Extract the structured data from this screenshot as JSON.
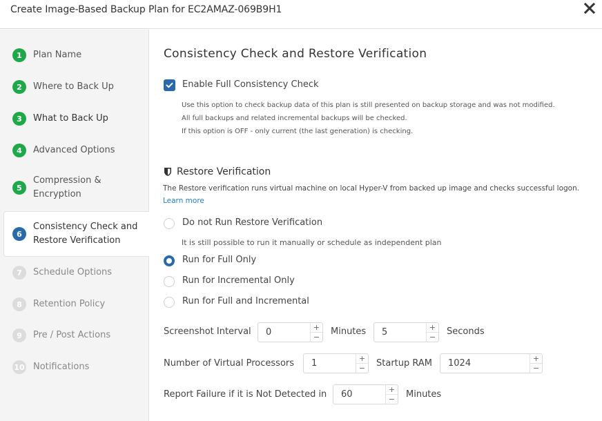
{
  "dialog": {
    "title": "Create Image-Based Backup Plan for EC2AMAZ-069B9H1",
    "close_icon": "close-x-icon"
  },
  "sidebar": {
    "steps": [
      {
        "number": "1",
        "label": "Plan Name",
        "state": "done"
      },
      {
        "number": "2",
        "label": "Where to Back Up",
        "state": "done"
      },
      {
        "number": "3",
        "label": "What to Back Up",
        "state": "done"
      },
      {
        "number": "4",
        "label": "Advanced Options",
        "state": "done"
      },
      {
        "number": "5",
        "label": "Compression & Encryption",
        "state": "done"
      },
      {
        "number": "6",
        "label": "Consistency Check and Restore Verification",
        "state": "active"
      },
      {
        "number": "7",
        "label": "Schedule Options",
        "state": "future"
      },
      {
        "number": "8",
        "label": "Retention Policy",
        "state": "future"
      },
      {
        "number": "9",
        "label": "Pre / Post Actions",
        "state": "future"
      },
      {
        "number": "10",
        "label": "Notifications",
        "state": "future"
      }
    ]
  },
  "main": {
    "title": "Consistency Check and Restore Verification",
    "consistency": {
      "checkbox_label": "Enable Full Consistency Check",
      "checked": true,
      "description": [
        "Use this option to check backup data of this plan is still presented on backup storage and was not modified.",
        "All full backups and related incremental backups will be checked.",
        "If this option is OFF - only current (the last generation) is checking."
      ]
    },
    "restore_verification": {
      "title": "Restore Verification",
      "icon": "shield-icon",
      "description": "The Restore verification runs virtual machine on local Hyper-V from backed up image and checks successful logon.",
      "learn_more": "Learn more",
      "options": [
        {
          "label": "Do not Run Restore Verification",
          "checked": false
        },
        {
          "label": "Run for Full Only",
          "checked": true
        },
        {
          "label": "Run for Incremental Only",
          "checked": false
        },
        {
          "label": "Run for Full and Incremental",
          "checked": false
        }
      ],
      "option_note": "It is still possible to run it manually or schedule as independent plan"
    },
    "settings": {
      "screenshot_interval_label": "Screenshot Interval",
      "screenshot_minutes": "0",
      "minutes_label": "Minutes",
      "screenshot_seconds": "5",
      "seconds_label": "Seconds",
      "processors_label": "Number of Virtual Processors",
      "processors": "1",
      "startup_ram_label": "Startup RAM",
      "startup_ram": "1024",
      "report_failure_label": "Report Failure if it is Not Detected in",
      "report_failure": "60",
      "report_minutes_label": "Minutes"
    },
    "spinner": {
      "plus": "+",
      "minus": "−"
    }
  }
}
